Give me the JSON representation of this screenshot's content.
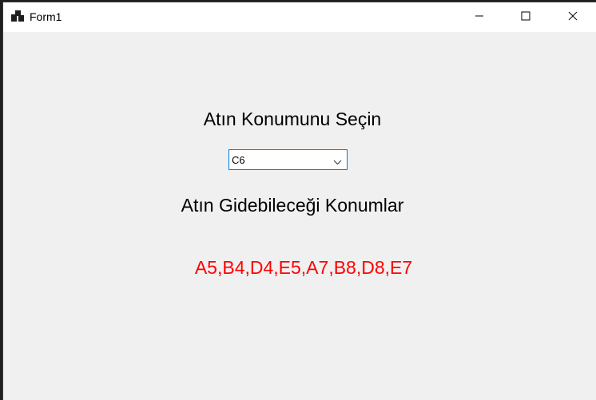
{
  "window": {
    "title": "Form1"
  },
  "form": {
    "select_label": "Atın Konumunu Seçin",
    "selected_position": "C6",
    "moves_label": "Atın Gidebileceği Konumlar",
    "moves_result": "A5,B4,D4,E5,A7,B8,D8,E7"
  },
  "icons": {
    "app": "form-app-icon",
    "minimize": "minimize-icon",
    "maximize": "maximize-icon",
    "close": "close-icon",
    "dropdown": "chevron-down-icon"
  },
  "colors": {
    "result_text": "#ff0000",
    "combo_border": "#0078d7",
    "client_background": "#f0f0f0"
  }
}
